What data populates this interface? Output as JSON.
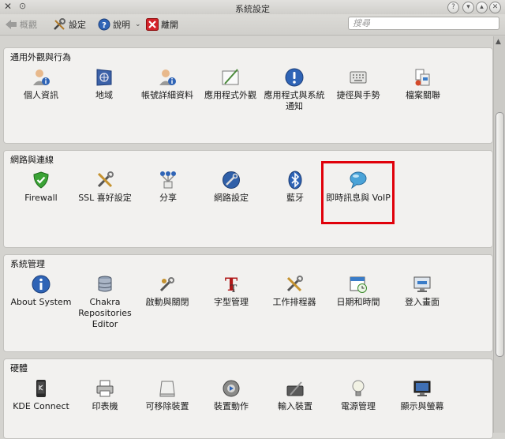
{
  "window": {
    "title": "系統設定"
  },
  "toolbar": {
    "back_label": "概觀",
    "settings_label": "設定",
    "help_label": "說明",
    "quit_label": "離開"
  },
  "search": {
    "placeholder": "搜尋"
  },
  "sections": [
    {
      "title": "通用外觀與行為",
      "items": [
        {
          "label": "個人資訊",
          "icon": "user-info-icon"
        },
        {
          "label": "地域",
          "icon": "flag-icon"
        },
        {
          "label": "帳號詳細資料",
          "icon": "user-account-icon"
        },
        {
          "label": "應用程式外觀",
          "icon": "appearance-icon"
        },
        {
          "label": "應用程式與系統通知",
          "icon": "notification-icon"
        },
        {
          "label": "捷徑與手勢",
          "icon": "keyboard-icon"
        },
        {
          "label": "檔案關聯",
          "icon": "file-association-icon"
        }
      ]
    },
    {
      "title": "網路與連線",
      "items": [
        {
          "label": "Firewall",
          "icon": "firewall-shield-icon"
        },
        {
          "label": "SSL 喜好設定",
          "icon": "ssl-tools-icon"
        },
        {
          "label": "分享",
          "icon": "network-share-icon"
        },
        {
          "label": "網路設定",
          "icon": "network-settings-icon"
        },
        {
          "label": "藍牙",
          "icon": "bluetooth-icon"
        },
        {
          "label": "即時訊息與 VoIP",
          "icon": "chat-bubble-icon"
        }
      ]
    },
    {
      "title": "系統管理",
      "items": [
        {
          "label": "About System",
          "icon": "info-icon"
        },
        {
          "label": "Chakra Repositories Editor",
          "icon": "database-icon"
        },
        {
          "label": "啟動與關閉",
          "icon": "startup-tools-icon"
        },
        {
          "label": "字型管理",
          "icon": "font-icon"
        },
        {
          "label": "工作排程器",
          "icon": "task-scheduler-icon"
        },
        {
          "label": "日期和時間",
          "icon": "calendar-clock-icon"
        },
        {
          "label": "登入畫面",
          "icon": "login-screen-icon"
        }
      ]
    },
    {
      "title": "硬體",
      "items": [
        {
          "label": "KDE Connect",
          "icon": "phone-icon"
        },
        {
          "label": "印表機",
          "icon": "printer-icon"
        },
        {
          "label": "可移除裝置",
          "icon": "removable-drive-icon"
        },
        {
          "label": "裝置動作",
          "icon": "device-actions-icon"
        },
        {
          "label": "輸入裝置",
          "icon": "input-device-icon"
        },
        {
          "label": "電源管理",
          "icon": "power-lightbulb-icon"
        },
        {
          "label": "顯示與螢幕",
          "icon": "monitor-icon"
        }
      ]
    }
  ]
}
